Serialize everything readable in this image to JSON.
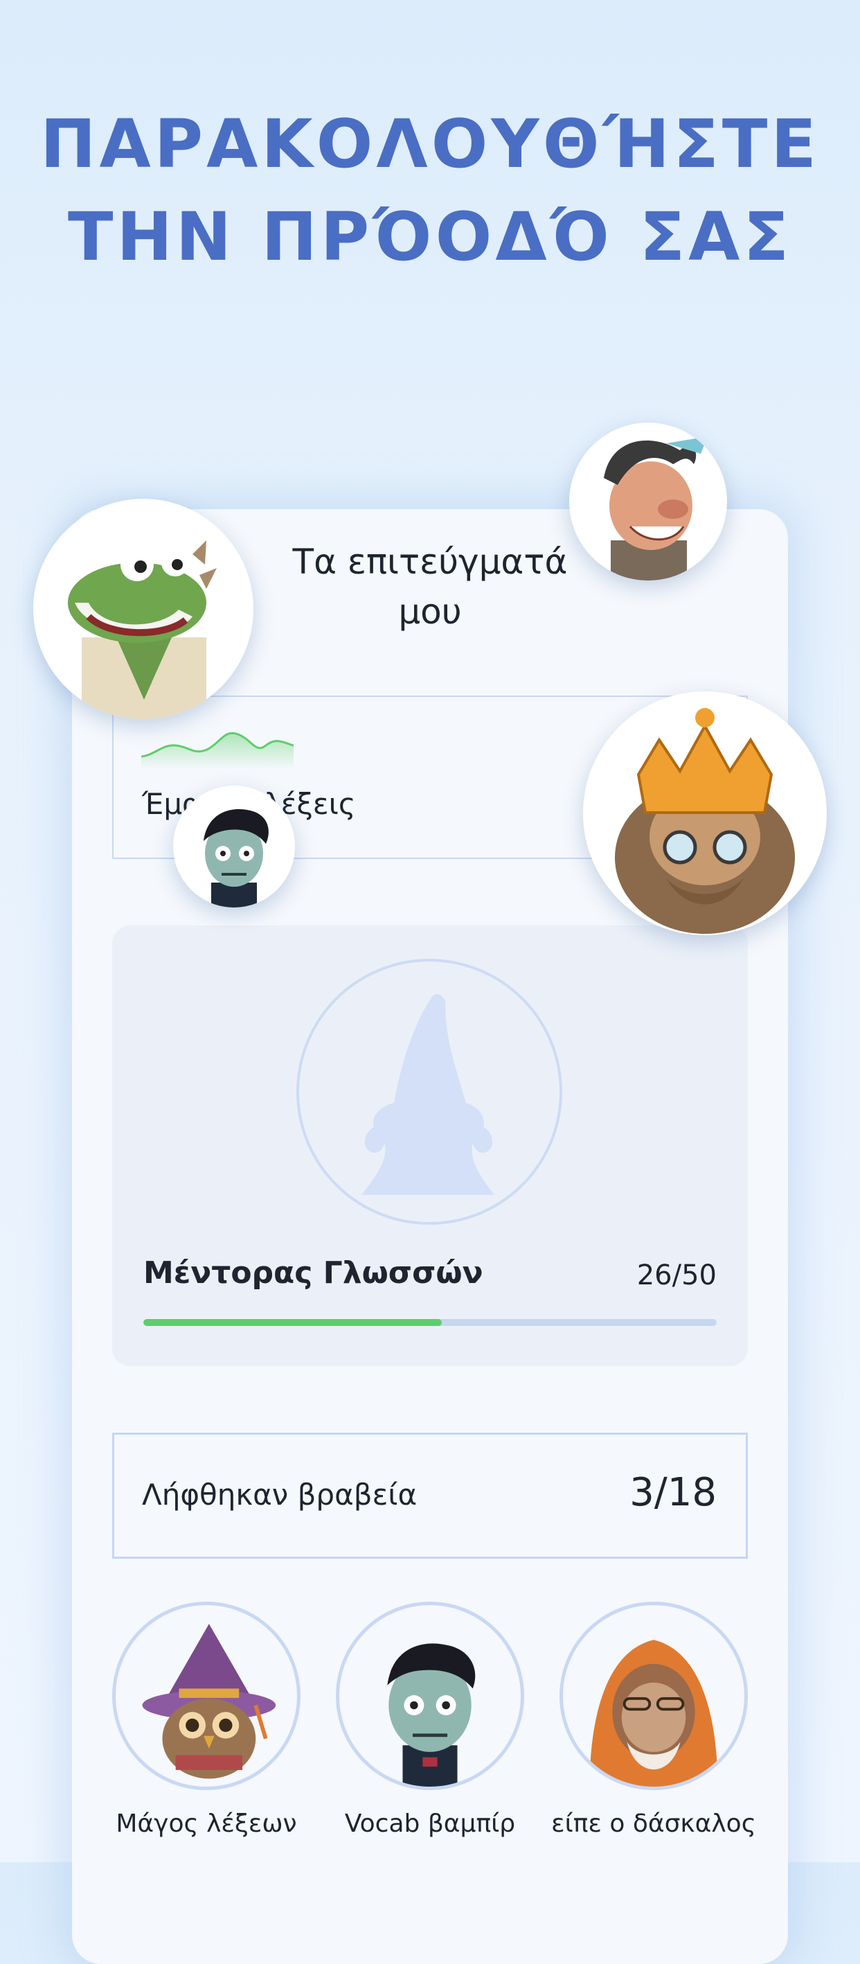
{
  "headline": {
    "line1": "ΠΑΡΑΚΟΛΟΥΘΉΣΤΕ",
    "line2": "ΤΗΝ ΠΡΌΟΔΌ ΣΑΣ"
  },
  "card": {
    "title_line1": "Τα επιτεύγματά",
    "title_line2": "μου"
  },
  "stat": {
    "label": "Έμαθαν λέξεις"
  },
  "mentor": {
    "name": "Μέντορας Γλωσσών",
    "count": "26/50",
    "progress": 0.52
  },
  "awards": {
    "label": "Λήφθηκαν βραβεία",
    "count": "3/18"
  },
  "badges": [
    {
      "label": "Μάγος λέξεων",
      "icon": "owl-wizard-icon"
    },
    {
      "label": "Vocab βαμπίρ",
      "icon": "zombie-vampire-icon"
    },
    {
      "label": "είπε ο δάσκαλος",
      "icon": "hooded-ape-icon"
    }
  ],
  "colors": {
    "headline": "#4a6ec4",
    "progress_fill": "#5fcd6c",
    "progress_track": "#c8d6f0",
    "border": "#c8d8f4"
  }
}
